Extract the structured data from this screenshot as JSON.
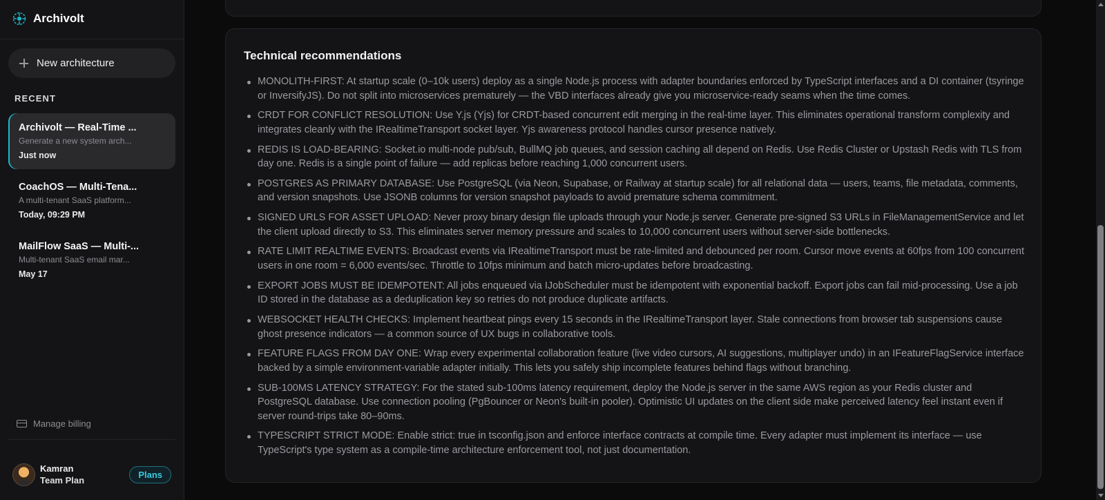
{
  "app": {
    "name": "Archivolt"
  },
  "sidebar": {
    "new_button_label": "New architecture",
    "recent_heading": "RECENT",
    "recent": [
      {
        "title": "Archivolt — Real-Time ...",
        "description": "Generate a new system arch...",
        "time": "Just now",
        "active": true
      },
      {
        "title": "CoachOS — Multi-Tena...",
        "description": "A multi-tenant SaaS platform...",
        "time": "Today, 09:29 PM",
        "active": false
      },
      {
        "title": "MailFlow SaaS — Multi-...",
        "description": "Multi-tenant SaaS email mar...",
        "time": "May 17",
        "active": false
      }
    ],
    "billing_label": "Manage billing",
    "user": {
      "name": "Kamran",
      "plan": "Team Plan"
    },
    "plans_button": "Plans"
  },
  "main": {
    "section_title": "Technical recommendations",
    "recommendations": [
      "MONOLITH-FIRST: At startup scale (0–10k users) deploy as a single Node.js process with adapter boundaries enforced by TypeScript interfaces and a DI container (tsyringe or InversifyJS). Do not split into microservices prematurely — the VBD interfaces already give you microservice-ready seams when the time comes.",
      "CRDT FOR CONFLICT RESOLUTION: Use Y.js (Yjs) for CRDT-based concurrent edit merging in the real-time layer. This eliminates operational transform complexity and integrates cleanly with the IRealtimeTransport socket layer. Yjs awareness protocol handles cursor presence natively.",
      "REDIS IS LOAD-BEARING: Socket.io multi-node pub/sub, BullMQ job queues, and session caching all depend on Redis. Use Redis Cluster or Upstash Redis with TLS from day one. Redis is a single point of failure — add replicas before reaching 1,000 concurrent users.",
      "POSTGRES AS PRIMARY DATABASE: Use PostgreSQL (via Neon, Supabase, or Railway at startup scale) for all relational data — users, teams, file metadata, comments, and version snapshots. Use JSONB columns for version snapshot payloads to avoid premature schema commitment.",
      "SIGNED URLS FOR ASSET UPLOAD: Never proxy binary design file uploads through your Node.js server. Generate pre-signed S3 URLs in FileManagementService and let the client upload directly to S3. This eliminates server memory pressure and scales to 10,000 concurrent users without server-side bottlenecks.",
      "RATE LIMIT REALTIME EVENTS: Broadcast events via IRealtimeTransport must be rate-limited and debounced per room. Cursor move events at 60fps from 100 concurrent users in one room = 6,000 events/sec. Throttle to 10fps minimum and batch micro-updates before broadcasting.",
      "EXPORT JOBS MUST BE IDEMPOTENT: All jobs enqueued via IJobScheduler must be idempotent with exponential backoff. Export jobs can fail mid-processing. Use a job ID stored in the database as a deduplication key so retries do not produce duplicate artifacts.",
      "WEBSOCKET HEALTH CHECKS: Implement heartbeat pings every 15 seconds in the IRealtimeTransport layer. Stale connections from browser tab suspensions cause ghost presence indicators — a common source of UX bugs in collaborative tools.",
      "FEATURE FLAGS FROM DAY ONE: Wrap every experimental collaboration feature (live video cursors, AI suggestions, multiplayer undo) in an IFeatureFlagService interface backed by a simple environment-variable adapter initially. This lets you safely ship incomplete features behind flags without branching.",
      "SUB-100MS LATENCY STRATEGY: For the stated sub-100ms latency requirement, deploy the Node.js server in the same AWS region as your Redis cluster and PostgreSQL database. Use connection pooling (PgBouncer or Neon's built-in pooler). Optimistic UI updates on the client side make perceived latency feel instant even if server round-trips take 80–90ms.",
      "TYPESCRIPT STRICT MODE: Enable strict: true in tsconfig.json and enforce interface contracts at compile time. Every adapter must implement its interface — use TypeScript's type system as a compile-time architecture enforcement tool, not just documentation."
    ]
  },
  "colors": {
    "accent": "#1fb7c9",
    "background": "#0b0b0c",
    "panel": "#141416"
  },
  "icons": {
    "logo": "archivolt-logo-icon",
    "new": "plus-icon",
    "billing": "credit-card-icon"
  }
}
